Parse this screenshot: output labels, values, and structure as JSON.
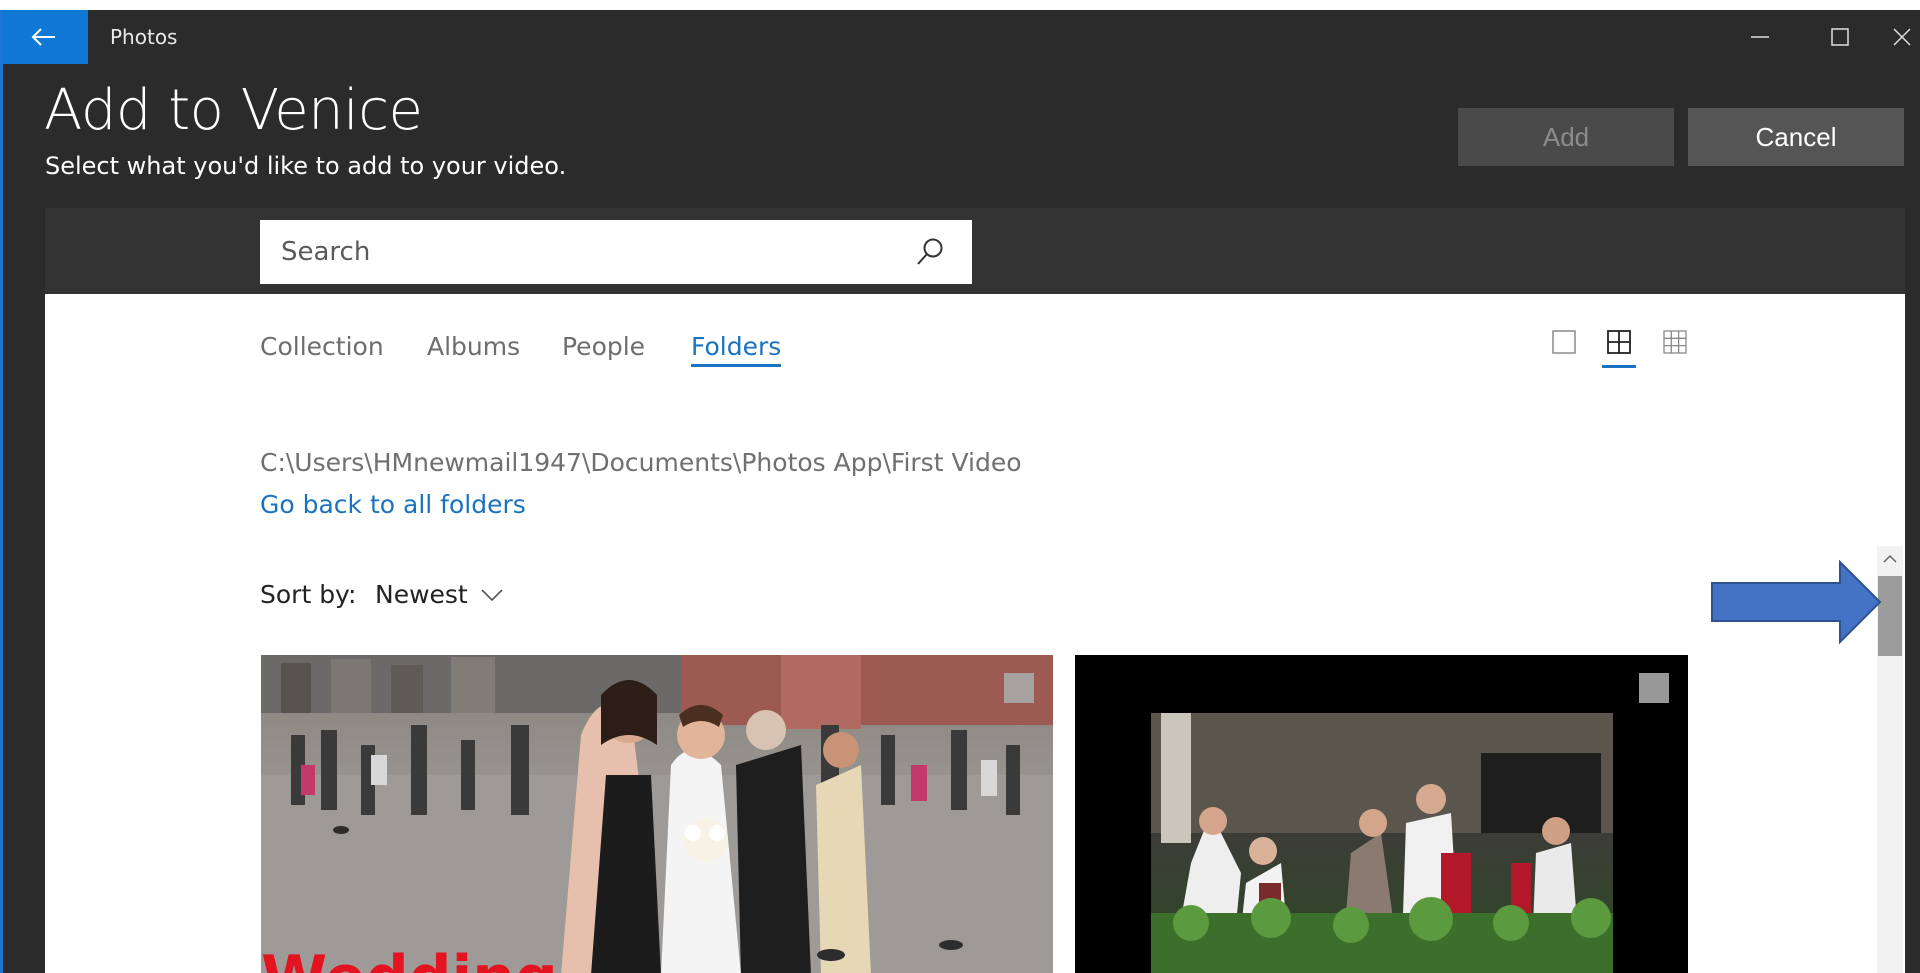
{
  "titlebar": {
    "app_name": "Photos",
    "back_icon": "back-arrow-icon",
    "controls": [
      "minimize-icon",
      "maximize-icon",
      "close-icon"
    ]
  },
  "header": {
    "title": "Add to Venice",
    "subtitle": "Select what you'd like to add to your video.",
    "add_label": "Add",
    "cancel_label": "Cancel"
  },
  "search": {
    "placeholder": "Search",
    "icon": "search-icon"
  },
  "tabs": [
    {
      "label": "Collection",
      "active": false
    },
    {
      "label": "Albums",
      "active": false
    },
    {
      "label": "People",
      "active": false
    },
    {
      "label": "Folders",
      "active": true
    }
  ],
  "view_modes": [
    {
      "icon": "single-view-icon",
      "active": false
    },
    {
      "icon": "medium-grid-icon",
      "active": true
    },
    {
      "icon": "small-grid-icon",
      "active": false
    }
  ],
  "folder": {
    "path": "C:\\Users\\HMnewmail1947\\Documents\\Photos App\\First Video",
    "back_link": "Go back to all folders"
  },
  "sort": {
    "label": "Sort by:",
    "value": "Newest"
  },
  "thumbnails": [
    {
      "caption": "Wedding",
      "subject": "wedding photo in Venice square"
    },
    {
      "caption": "",
      "subject": "string quartet concert"
    }
  ],
  "colors": {
    "accent": "#1a73c1",
    "back_button": "#0f78d4",
    "chrome": "#2b2b2b",
    "caption_red": "#e3141f",
    "annotation_arrow": "#4472c4"
  }
}
